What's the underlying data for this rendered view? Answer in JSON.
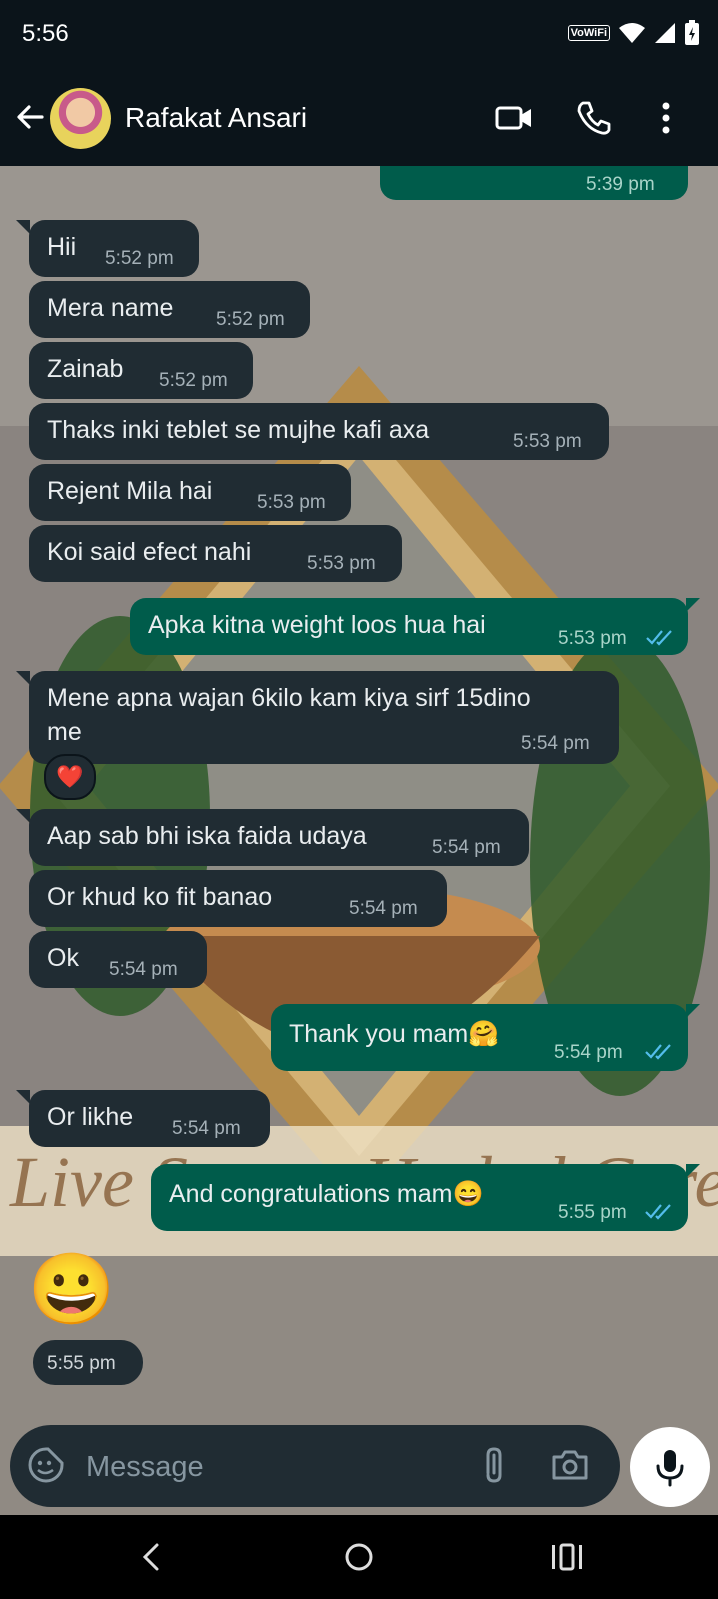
{
  "status_bar": {
    "time": "5:56",
    "vowifi": "VoWiFi"
  },
  "header": {
    "contact_name": "Rafakat Ansari"
  },
  "chat": {
    "partial_top_time": "5:39 pm",
    "messages": [
      {
        "text": "Hii",
        "time": "5:52 pm",
        "dir": "in"
      },
      {
        "text": "Mera name",
        "time": "5:52 pm",
        "dir": "in"
      },
      {
        "text": "Zainab",
        "time": "5:52 pm",
        "dir": "in"
      },
      {
        "text": "Thaks inki teblet se mujhe kafi axa",
        "time": "5:53 pm",
        "dir": "in"
      },
      {
        "text": "Rejent Mila hai",
        "time": "5:53 pm",
        "dir": "in"
      },
      {
        "text": "Koi said efect nahi",
        "time": "5:53 pm",
        "dir": "in"
      },
      {
        "text": "Apka kitna weight loos hua hai",
        "time": "5:53 pm",
        "dir": "out"
      },
      {
        "text_line1": "Mene apna wajan 6kilo kam kiya sirf 15dino",
        "text_line2": "me",
        "time": "5:54 pm",
        "dir": "in",
        "reaction": "❤️"
      },
      {
        "text": "Aap sab bhi iska faida udaya",
        "time": "5:54 pm",
        "dir": "in"
      },
      {
        "text": "Or khud ko fit  banao",
        "time": "5:54 pm",
        "dir": "in"
      },
      {
        "text": "Ok",
        "time": "5:54 pm",
        "dir": "in"
      },
      {
        "text": "Thank you mam🤗",
        "time": "5:54 pm",
        "dir": "out"
      },
      {
        "text": "Or likhe",
        "time": "5:54 pm",
        "dir": "in"
      },
      {
        "text": "And congratulations mam😄",
        "time": "5:55 pm",
        "dir": "out"
      },
      {
        "emoji": "😀",
        "time": "5:55 pm",
        "dir": "in"
      }
    ],
    "wallpaper_text": "Live Secure Herbal Care"
  },
  "composer": {
    "placeholder": "Message"
  },
  "colors": {
    "incoming_bubble": "#202c33",
    "outgoing_bubble": "#005c4b",
    "read_ticks": "#53bdeb"
  },
  "icons": {
    "back": "arrow-left-icon",
    "video": "video-call-icon",
    "phone": "phone-icon",
    "menu": "more-vert-icon",
    "sticker": "sticker-icon",
    "attach": "paperclip-icon",
    "camera": "camera-icon",
    "mic": "mic-icon",
    "nav_back": "nav-back-icon",
    "nav_home": "nav-home-icon",
    "nav_recents": "nav-recents-icon"
  }
}
